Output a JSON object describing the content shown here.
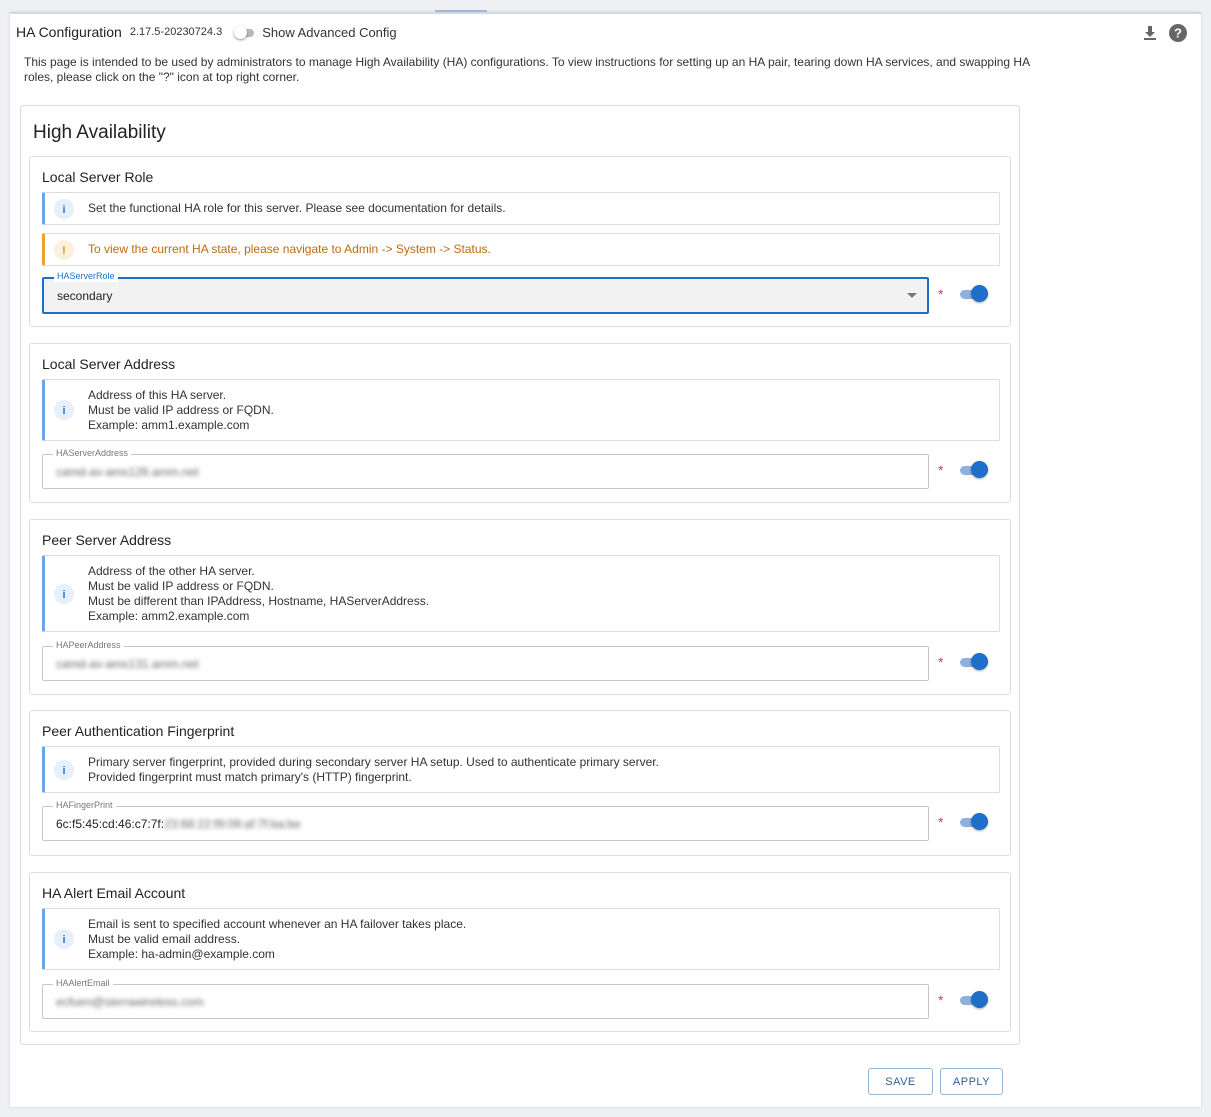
{
  "header": {
    "title": "HA Configuration",
    "version": "2.17.5-20230724.3",
    "advanced_toggle_label": "Show Advanced Config"
  },
  "icons": {
    "download": "download-icon",
    "help": "help-icon",
    "info": "info-icon",
    "warning": "warning-icon"
  },
  "intro": "This page is intended to be used by administrators to manage High Availability (HA) configurations. To view instructions for setting up an HA pair, tearing down HA services, and swapping HA roles, please click on the \"?\" icon at top right corner.",
  "card": {
    "title": "High Availability"
  },
  "sections": {
    "role": {
      "title": "Local Server Role",
      "info": "Set the functional HA role for this server. Please see documentation for details.",
      "warning": "To view the current HA state, please navigate to Admin -> System -> Status.",
      "field_label": "HAServerRole",
      "field_value": "secondary"
    },
    "local_address": {
      "title": "Local Server Address",
      "info_lines": [
        "Address of this HA server.",
        "Must be valid IP address or FQDN.",
        "Example: amm1.example.com"
      ],
      "field_label": "HAServerAddress",
      "field_value": "camd-av-ams126.amm.net"
    },
    "peer_address": {
      "title": "Peer Server Address",
      "info_lines": [
        "Address of the other HA server.",
        "Must be valid IP address or FQDN.",
        "Must be different than IPAddress, Hostname, HAServerAddress.",
        "Example: amm2.example.com"
      ],
      "field_label": "HAPeerAddress",
      "field_value": "camd-av-ams131.amm.net"
    },
    "fingerprint": {
      "title": "Peer Authentication Fingerprint",
      "info_lines": [
        "Primary server fingerprint, provided during secondary server HA setup. Used to authenticate primary server.",
        "Provided fingerprint must match primary's (HTTP) fingerprint."
      ],
      "field_label": "HAFingerPrint",
      "field_value_visible": "6c:f5:45:cd:46:c7:7f:",
      "field_value_hidden": "23:68:22:f9:09:af:7f:ba:be"
    },
    "alert_email": {
      "title": "HA Alert Email Account",
      "info_lines": [
        "Email is sent to specified account whenever an HA failover takes place.",
        "Must be valid email address.",
        "Example: ha-admin@example.com"
      ],
      "field_label": "HAAlertEmail",
      "field_value": "ecfuen@sierrawireless.com"
    }
  },
  "required_marker": "*",
  "buttons": {
    "save": "SAVE",
    "apply": "APPLY"
  },
  "colors": {
    "accent": "#1f6fc9",
    "required": "#e0336b",
    "warning_text": "#c06a0c",
    "info_border": "#6ba5e6"
  }
}
